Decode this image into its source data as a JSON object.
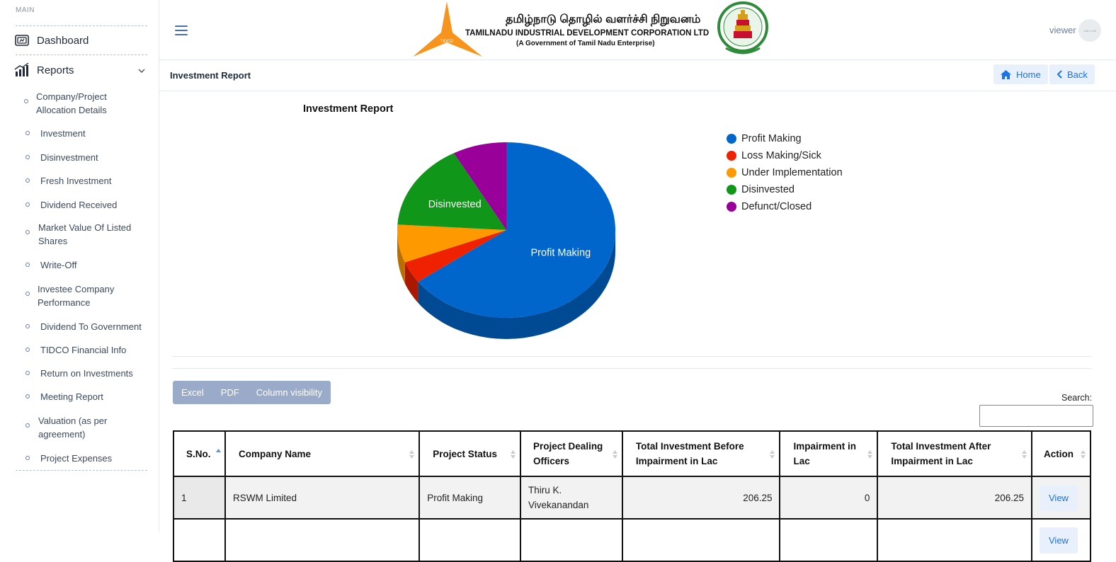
{
  "sidebar": {
    "section": "MAIN",
    "dashboard": "Dashboard",
    "reports": "Reports",
    "items": [
      {
        "label": "Company/Project Allocation Details"
      },
      {
        "label": "Investment"
      },
      {
        "label": "Disinvestment"
      },
      {
        "label": "Fresh Investment"
      },
      {
        "label": "Dividend Received"
      },
      {
        "label": "Market Value Of Listed Shares"
      },
      {
        "label": "Write-Off"
      },
      {
        "label": "Investee Company Performance"
      },
      {
        "label": "Dividend To Government"
      },
      {
        "label": "TIDCO Financial Info"
      },
      {
        "label": "Return on Investments"
      },
      {
        "label": "Meeting Report"
      },
      {
        "label": "Valuation (as per agreement)"
      },
      {
        "label": "Project Expenses"
      }
    ]
  },
  "header": {
    "logo_tamil": "தமிழ்நாடு தொழில் வளர்ச்சி நிறுவனம்",
    "logo_name": "TAMILNADU INDUSTRIAL DEVELOPMENT CORPORATION LTD",
    "logo_sub": "(A Government of Tamil Nadu Enterprise)",
    "logo_badge": "TIDCO",
    "user": "viewer",
    "avatar_text": "128 x 128"
  },
  "breadcrumb": {
    "title": "Investment Report",
    "home": "Home",
    "back": "Back"
  },
  "colors": {
    "profit": "#0066cc",
    "loss": "#ee2200",
    "under": "#ff9900",
    "disinvested": "#109618",
    "defunct": "#990099"
  },
  "chart_data": {
    "type": "pie",
    "title": "Investment Report",
    "three_d": true,
    "legend_position": "right",
    "slices": [
      {
        "label": "Profit Making",
        "value": 65,
        "color": "#0066cc",
        "show_label": true
      },
      {
        "label": "Loss Making/Sick",
        "value": 4,
        "color": "#ee2200",
        "show_label": false
      },
      {
        "label": "Under Implementation",
        "value": 7,
        "color": "#ff9900",
        "show_label": false
      },
      {
        "label": "Disinvested",
        "value": 16,
        "color": "#109618",
        "show_label": true
      },
      {
        "label": "Defunct/Closed",
        "value": 8,
        "color": "#990099",
        "show_label": false
      }
    ]
  },
  "table_controls": {
    "excel": "Excel",
    "pdf": "PDF",
    "colvis": "Column visibility",
    "search_label": "Search:"
  },
  "table": {
    "headers": {
      "sno": "S.No.",
      "company": "Company Name",
      "status": "Project Status",
      "officers": "Project Dealing Officers",
      "before": "Total Investment Before Impairment in Lac",
      "impairment": "Impairment in Lac",
      "after": "Total Investment After Impairment in Lac",
      "action": "Action"
    },
    "rows": [
      {
        "sno": "1",
        "company": "RSWM Limited",
        "status": "Profit Making",
        "officers": "Thiru K. Vivekanandan",
        "before": "206.25",
        "impairment": "0",
        "after": "206.25",
        "action": "View"
      },
      {
        "sno": "",
        "company": "",
        "status": "",
        "officers": "",
        "before": "",
        "impairment": "",
        "after": "",
        "action": "View"
      }
    ]
  }
}
